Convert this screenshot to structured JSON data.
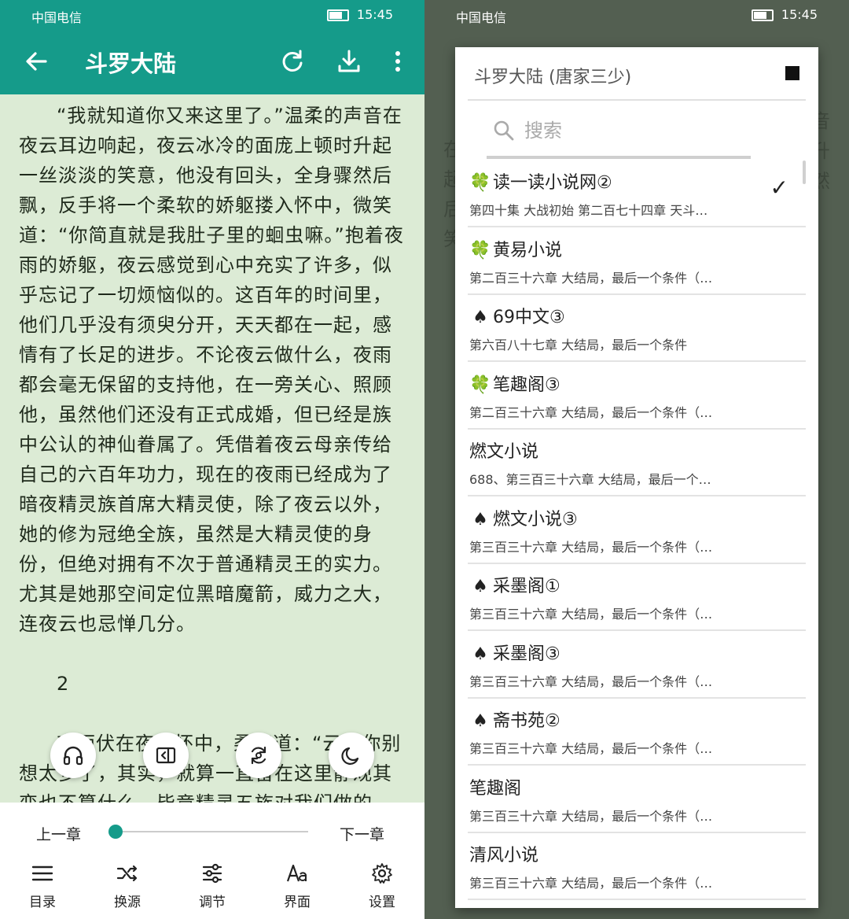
{
  "left": {
    "status": {
      "carrier": "中国电信",
      "time": "15:45"
    },
    "appbar": {
      "title": "斗罗大陆"
    },
    "reader": {
      "paragraph1": "“我就知道你又来这里了。”温柔的声音在夜云耳边响起，夜云冰冷的面庞上顿时升起一丝淡淡的笑意，他没有回头，全身骤然后飘，反手将一个柔软的娇躯搂入怀中，微笑道：“你简直就是我肚子里的蛔虫嘛。”抱着夜雨的娇躯，夜云感觉到心中充实了许多，似乎忘记了一切烦恼似的。这百年的时间里，他们几乎没有须臾分开，天天都在一起，感情有了长足的进步。不论夜云做什么，夜雨都会毫无保留的支持他，在一旁关心、照顾他，虽然他们还没有正式成婚，但已经是族中公认的神仙眷属了。凭借着夜云母亲传给自己的六百年功力，现在的夜雨已经成为了暗夜精灵族首席大精灵使，除了夜云以外，她的修为冠绝全族，虽然是大精灵使的身份，但绝对拥有不次于普通精灵王的实力。尤其是她那空间定位黑暗魔箭，威力之大，连夜云也忌惮几分。",
      "chapter_num": "2",
      "paragraph2": "夜雨伏在夜云怀中，柔声道：“云，你别想太多了，其实，就算一直留在这里静观其变也不算什么。毕竟精灵五族对我们做的"
    },
    "controls": {
      "prev_chapter": "上一章",
      "next_chapter": "下一章",
      "progress": 0,
      "tools": [
        {
          "label": "目录",
          "icon": "menu-icon"
        },
        {
          "label": "换源",
          "icon": "shuffle-icon"
        },
        {
          "label": "调节",
          "icon": "sliders-icon"
        },
        {
          "label": "界面",
          "icon": "font-icon"
        },
        {
          "label": "设置",
          "icon": "gear-icon"
        }
      ]
    },
    "fabs": [
      "headphones-icon",
      "auto-page-icon",
      "refresh-icon",
      "night-mode-icon"
    ],
    "colors": {
      "primary": "#159b8a",
      "paper": "#dcebd5"
    }
  },
  "right": {
    "status": {
      "carrier": "中国电信",
      "time": "15:45"
    },
    "dialog": {
      "title": "斗罗大陆 (唐家三少)",
      "search_placeholder": "搜索",
      "sources": [
        {
          "mark": "🍀",
          "name": "读一读小说网②",
          "latest": "第四十集 大战初始 第二百七十四章 天斗…",
          "selected": true
        },
        {
          "mark": "🍀",
          "name": "黄易小说",
          "latest": "第二百三十六章 大结局，最后一个条件（…",
          "selected": false
        },
        {
          "mark": "♠",
          "name": "69中文③",
          "latest": "第六百八十七章 大结局，最后一个条件",
          "selected": false
        },
        {
          "mark": "🍀",
          "name": "笔趣阁③",
          "latest": "第二百三十六章 大结局，最后一个条件（…",
          "selected": false
        },
        {
          "mark": "",
          "name": "燃文小说",
          "latest": "688、第三百三十六章 大结局，最后一个…",
          "selected": false
        },
        {
          "mark": "♠",
          "name": "燃文小说③",
          "latest": "第三百三十六章 大结局，最后一个条件（…",
          "selected": false
        },
        {
          "mark": "♠",
          "name": "采墨阁①",
          "latest": "第三百三十六章 大结局，最后一个条件（…",
          "selected": false
        },
        {
          "mark": "♠",
          "name": "采墨阁③",
          "latest": "第三百三十六章 大结局，最后一个条件（…",
          "selected": false
        },
        {
          "mark": "♠",
          "name": "斋书苑②",
          "latest": "第三百三十六章 大结局，最后一个条件（…",
          "selected": false
        },
        {
          "mark": "",
          "name": "笔趣阁",
          "latest": "第三百三十六章 大结局，最后一个条件（…",
          "selected": false
        },
        {
          "mark": "",
          "name": "清风小说",
          "latest": "第三百三十六章 大结局，最后一个条件（…",
          "selected": false
        }
      ]
    }
  }
}
